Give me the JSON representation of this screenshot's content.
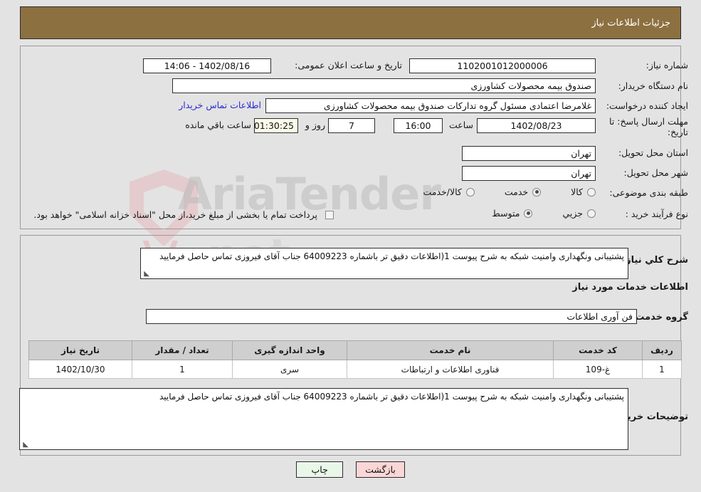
{
  "header": {
    "title": "جزئیات اطلاعات نیاز"
  },
  "top_form": {
    "need_number_label": "شماره نیاز:",
    "need_number_value": "1102001012000006",
    "announce_datetime_label": "تاریخ و ساعت اعلان عمومی:",
    "announce_datetime_value": "1402/08/16 - 14:06",
    "buyer_org_label": "نام دستگاه خریدار:",
    "buyer_org_value": "صندوق بیمه محصولات کشاورزی",
    "creator_label": "ایجاد کننده درخواست:",
    "creator_value": "غلامرضا اعتمادی مسئول گروه تدارکات صندوق بیمه محصولات کشاورزی",
    "buyer_contact_link": "اطلاعات تماس خریدار",
    "deadline_label": "مهلت ارسال پاسخ: تا تاریخ:",
    "deadline_date": "1402/08/23",
    "deadline_hour_label": "ساعت",
    "deadline_hour_value": "16:00",
    "days_value": "7",
    "days_suffix": "روز و",
    "countdown_value": "01:30:25",
    "countdown_suffix": "ساعت باقي مانده",
    "province_label": "استان محل تحویل:",
    "province_value": "تهران",
    "city_label": "شهر محل تحویل:",
    "city_value": "تهران",
    "category_label": "طبقه بندی موضوعی:",
    "category_options": [
      {
        "label": "کالا",
        "checked": false
      },
      {
        "label": "خدمت",
        "checked": true
      },
      {
        "label": "کالا/خدمت",
        "checked": false
      }
    ],
    "process_label": "نوع فرآیند خرید :",
    "process_options": [
      {
        "label": "جزیي",
        "checked": false
      },
      {
        "label": "متوسط",
        "checked": true
      }
    ],
    "treasury_checkbox_checked": false,
    "treasury_note": "پرداخت تمام یا بخشی از مبلغ خرید،از محل \"اسناد خزانه اسلامی\" خواهد بود."
  },
  "middle": {
    "overall_desc_label": "شرح کلي نياز:",
    "overall_desc_value": "پشتیبانی ونگهداری وامنیت شبکه به شرح پیوست 1(اطلاعات دقیق تر باشماره 64009223 جناب آقای فیروزی تماس حاصل فرمایید",
    "services_heading": "اطلاعات خدمات مورد نیاز",
    "service_group_label": "گروه خدمت:",
    "service_group_value": "فن آوری اطلاعات",
    "buyer_notes_label": "توضیحات خریدار:",
    "buyer_notes_value": "پشتیبانی ونگهداری وامنیت شبکه به شرح پیوست 1(اطلاعات دقیق تر باشماره 64009223 جناب آقای فیروزی تماس حاصل فرمایید"
  },
  "table": {
    "columns": [
      "ردیف",
      "کد خدمت",
      "نام خدمت",
      "واحد اندازه گیری",
      "تعداد / مقدار",
      "تاریخ نیاز"
    ],
    "rows": [
      {
        "row_no": "1",
        "service_code": "غ-109",
        "service_name": "فناوری اطلاعات و ارتباطات",
        "unit": "سری",
        "quantity": "1",
        "need_date": "1402/10/30"
      }
    ]
  },
  "footer": {
    "print_label": "چاپ",
    "back_label": "بازگشت"
  },
  "watermark": {
    "text": "AriaTender",
    "text2": ".net"
  },
  "colors": {
    "header_bg": "#8d7040",
    "link": "#2b2bd8",
    "table_header_bg": "#cfcfcf",
    "print_btn_bg": "#e9f7e9",
    "back_btn_bg": "#fbd6d6",
    "countdown_bg": "#fbfbe8"
  }
}
